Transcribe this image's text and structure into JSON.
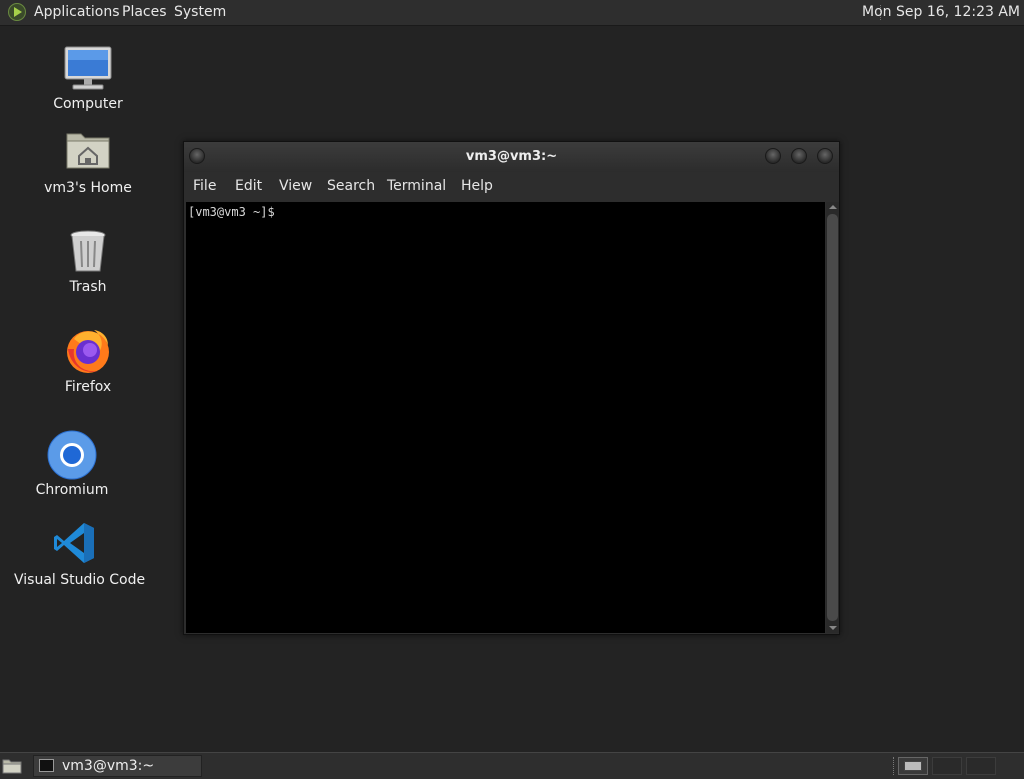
{
  "top_panel": {
    "menus": [
      "Applications",
      "Places",
      "System"
    ],
    "clock": "Mon Sep 16, 12:23 AM"
  },
  "desktop": {
    "icons": [
      {
        "label": "Computer",
        "icon": "computer-icon"
      },
      {
        "label": "vm3's Home",
        "icon": "home-folder-icon"
      },
      {
        "label": "Trash",
        "icon": "trash-icon"
      },
      {
        "label": "Firefox",
        "icon": "firefox-icon"
      },
      {
        "label": "Chromium",
        "icon": "chromium-icon"
      },
      {
        "label": "Visual Studio Code",
        "icon": "vscode-icon"
      }
    ]
  },
  "terminal": {
    "title": "vm3@vm3:~",
    "menu": [
      "File",
      "Edit",
      "View",
      "Search",
      "Terminal",
      "Help"
    ],
    "prompt": "[vm3@vm3 ~]$"
  },
  "taskbar": {
    "window_label": "vm3@vm3:~"
  },
  "colors": {
    "desktop_bg": "#232323",
    "panel_bg": "#2e2e2e",
    "terminal_bg": "#000000"
  }
}
